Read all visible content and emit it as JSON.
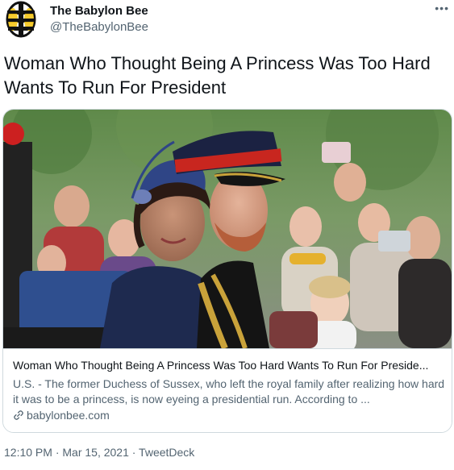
{
  "author": {
    "name": "The Babylon Bee",
    "handle": "@TheBabylonBee",
    "avatar_icon": "bee-logo-icon"
  },
  "menu": {
    "more_label": "•••"
  },
  "tweet": {
    "text": "Woman Who Thought Being A Princess Was Too Hard Wants To Run For President"
  },
  "card": {
    "image_alt": "Photo of a woman in a navy hat beside a man in a red and black military cap, crowd in background",
    "title": "Woman Who Thought Being A Princess Was Too Hard Wants To Run For Preside...",
    "description": "U.S. - The former Duchess of Sussex, who left the royal family after realizing how hard it was to be a princess, is now eyeing a presidential run. According to ...",
    "domain": "babylonbee.com",
    "link_icon": "link-icon"
  },
  "meta": {
    "timestamp": "12:10 PM · Mar 15, 2021 · TweetDeck"
  },
  "colors": {
    "text": "#0f1419",
    "secondary": "#536471",
    "border": "#cfd9de",
    "logo_yellow": "#f5c518"
  }
}
